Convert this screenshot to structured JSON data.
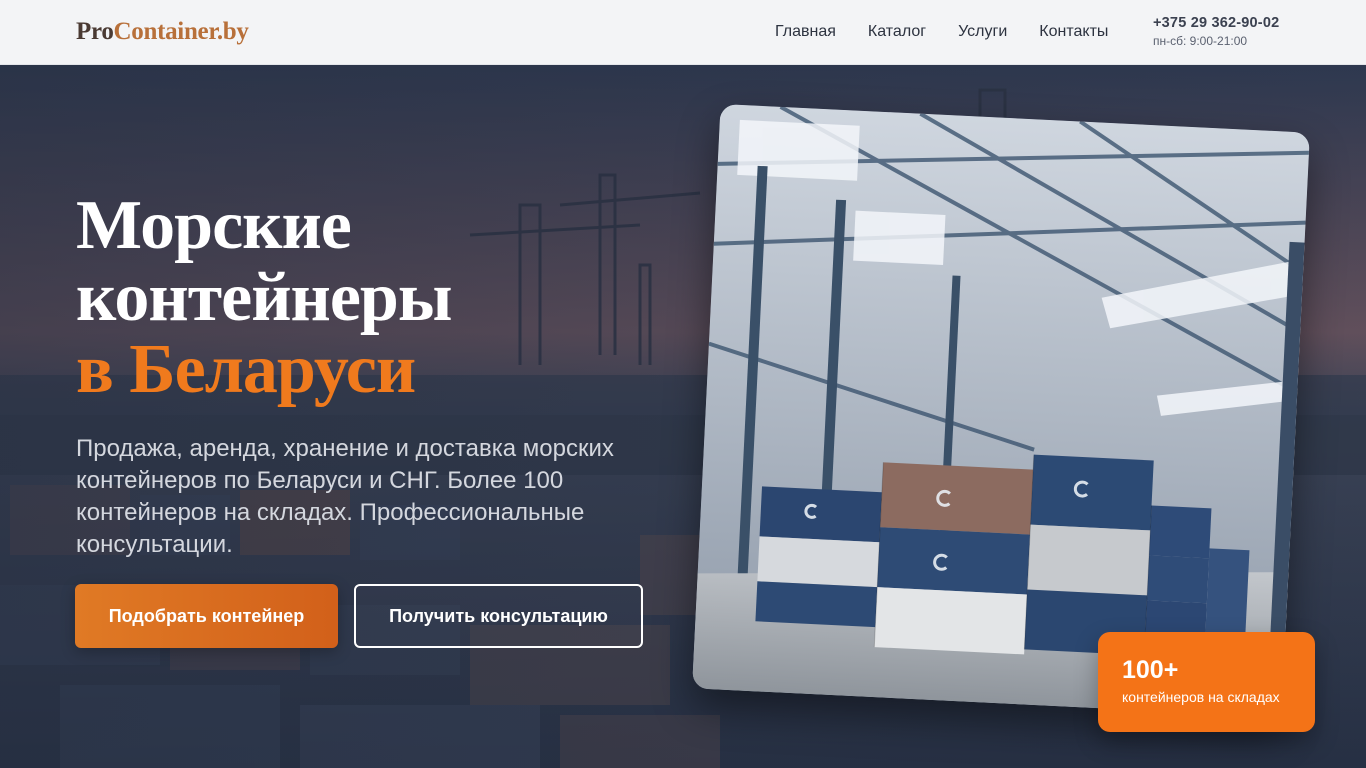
{
  "header": {
    "logo_part1": "Pro",
    "logo_part2": "Container.by",
    "nav": [
      "Главная",
      "Каталог",
      "Услуги",
      "Контакты"
    ],
    "phone": "+375 29 362-90-02",
    "hours": "пн-сб: 9:00-21:00"
  },
  "hero": {
    "title_line1": "Морские",
    "title_line2": "контейнеры",
    "title_accent": "в Беларуси",
    "subtitle": "Продажа, аренда, хранение и доставка морских контейнеров по Беларуси и СНГ. Более 100 контейнеров на складах. Профессиональные консультации.",
    "primary_button": "Подобрать контейнер",
    "secondary_button": "Получить консультацию"
  },
  "stat": {
    "number": "100+",
    "label": "контейнеров на складах"
  },
  "colors": {
    "accent": "#f07a1d",
    "stat_bg": "#f47317",
    "header_bg": "#f3f4f6"
  },
  "icons": {
    "container_logo": "container-c-mark"
  }
}
